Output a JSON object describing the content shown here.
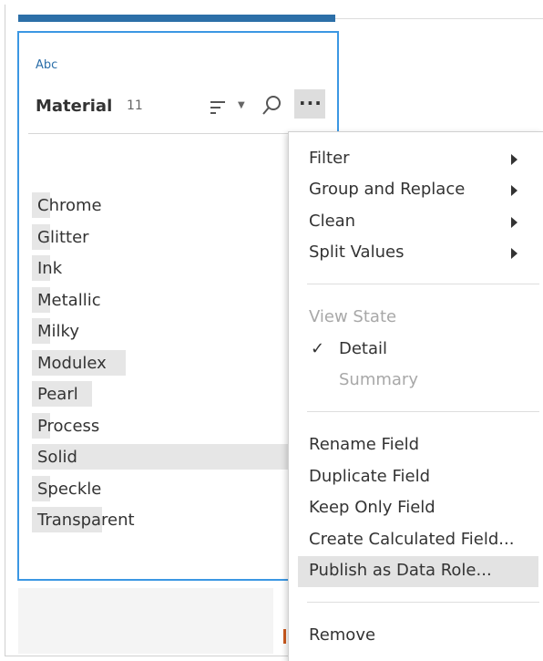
{
  "field": {
    "type_label": "Abc",
    "name": "Material",
    "count": "11"
  },
  "values": [
    {
      "label": "Chrome",
      "frequency": 0.07
    },
    {
      "label": "Glitter",
      "frequency": 0.07
    },
    {
      "label": "Ink",
      "frequency": 0.07
    },
    {
      "label": "Metallic",
      "frequency": 0.07
    },
    {
      "label": "Milky",
      "frequency": 0.07
    },
    {
      "label": "Modulex",
      "frequency": 0.36
    },
    {
      "label": "Pearl",
      "frequency": 0.23
    },
    {
      "label": "Process",
      "frequency": 0.07
    },
    {
      "label": "Solid",
      "frequency": 1.0
    },
    {
      "label": "Speckle",
      "frequency": 0.07
    },
    {
      "label": "Transparent",
      "frequency": 0.27
    }
  ],
  "menu": {
    "filter": "Filter",
    "group_replace": "Group and Replace",
    "clean": "Clean",
    "split_values": "Split Values",
    "view_state": "View State",
    "check_mark": "✓",
    "detail": "Detail",
    "summary": "Summary",
    "rename_field": "Rename Field",
    "duplicate_field": "Duplicate Field",
    "keep_only_field": "Keep Only Field",
    "create_calculated_field": "Create Calculated Field...",
    "publish_data_role": "Publish as Data Role...",
    "remove": "Remove"
  },
  "icons": {
    "sort": "sort-icon",
    "search": "search-icon",
    "more": "more-options-icon",
    "submenu": "chevron-right-icon",
    "check": "checkmark-icon"
  },
  "colors": {
    "accent": "#3b97e3",
    "header_bar": "#2c6fa8",
    "bar_fill": "#e6e6e6",
    "highlight": "#e3e3e3"
  }
}
